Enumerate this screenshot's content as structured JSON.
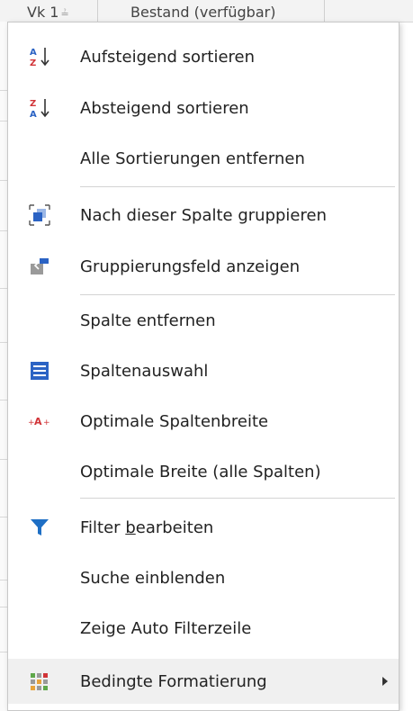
{
  "grid": {
    "col1_header": "Vk 1",
    "col2_header": "Bestand (verfügbar)"
  },
  "menu": {
    "items": [
      {
        "label": "Aufsteigend sortieren",
        "icon": "sort-ascending-icon"
      },
      {
        "label": "Absteigend sortieren",
        "icon": "sort-descending-icon"
      },
      {
        "label": "Alle Sortierungen entfernen",
        "icon": ""
      },
      {
        "label": "Nach dieser Spalte gruppieren",
        "icon": "group-by-column-icon"
      },
      {
        "label": "Gruppierungsfeld anzeigen",
        "icon": "group-panel-icon"
      },
      {
        "label": "Spalte entfernen",
        "icon": ""
      },
      {
        "label": "Spaltenauswahl",
        "icon": "column-chooser-icon"
      },
      {
        "label": "Optimale Spaltenbreite",
        "icon": "best-fit-icon"
      },
      {
        "label": "Optimale Breite (alle Spalten)",
        "icon": ""
      },
      {
        "label_pre": "Filter ",
        "label_ul": "b",
        "label_post": "earbeiten",
        "icon": "filter-icon"
      },
      {
        "label": "Suche einblenden",
        "icon": ""
      },
      {
        "label": "Zeige Auto Filterzeile",
        "icon": ""
      },
      {
        "label": "Bedingte Formatierung",
        "icon": "conditional-format-icon",
        "has_submenu": true
      }
    ],
    "colors": {
      "accent_blue": "#2b63c4",
      "filter_blue": "#1e6fc5",
      "sort_red": "#d13438",
      "hover_bg": "#f0f0f0"
    }
  }
}
